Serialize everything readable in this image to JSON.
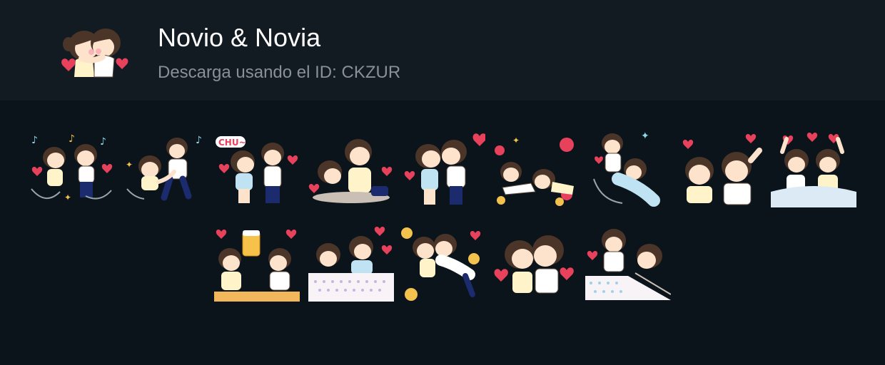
{
  "pack": {
    "title": "Novio & Novia",
    "subtitle_prefix": "Descarga usando el ID: ",
    "id_code": "CKZUR",
    "icon": "couple-hug-sticker-icon"
  },
  "stickers": {
    "row1": [
      {
        "name": "sticker-dancing-couple"
      },
      {
        "name": "sticker-running-couple"
      },
      {
        "name": "sticker-chu-kiss",
        "caption": "CHU~"
      },
      {
        "name": "sticker-lap-rest"
      },
      {
        "name": "sticker-cheek-kiss"
      },
      {
        "name": "sticker-lying-flowers"
      },
      {
        "name": "sticker-hug-spin"
      },
      {
        "name": "sticker-crying-happy"
      },
      {
        "name": "sticker-cheering-car"
      }
    ],
    "row2": [
      {
        "name": "sticker-beer-toast"
      },
      {
        "name": "sticker-bed-pillow-talk"
      },
      {
        "name": "sticker-flowers-push"
      },
      {
        "name": "sticker-cheek-hug"
      },
      {
        "name": "sticker-bed-tickle"
      }
    ]
  },
  "colors": {
    "background": "#0b131b",
    "header_bg": "#121a22",
    "title": "#ffffff",
    "subtitle": "#8a9096",
    "heart": "#e8415c",
    "hair": "#4a3528",
    "skin": "#fde3cc",
    "navy": "#1c2a6e"
  }
}
